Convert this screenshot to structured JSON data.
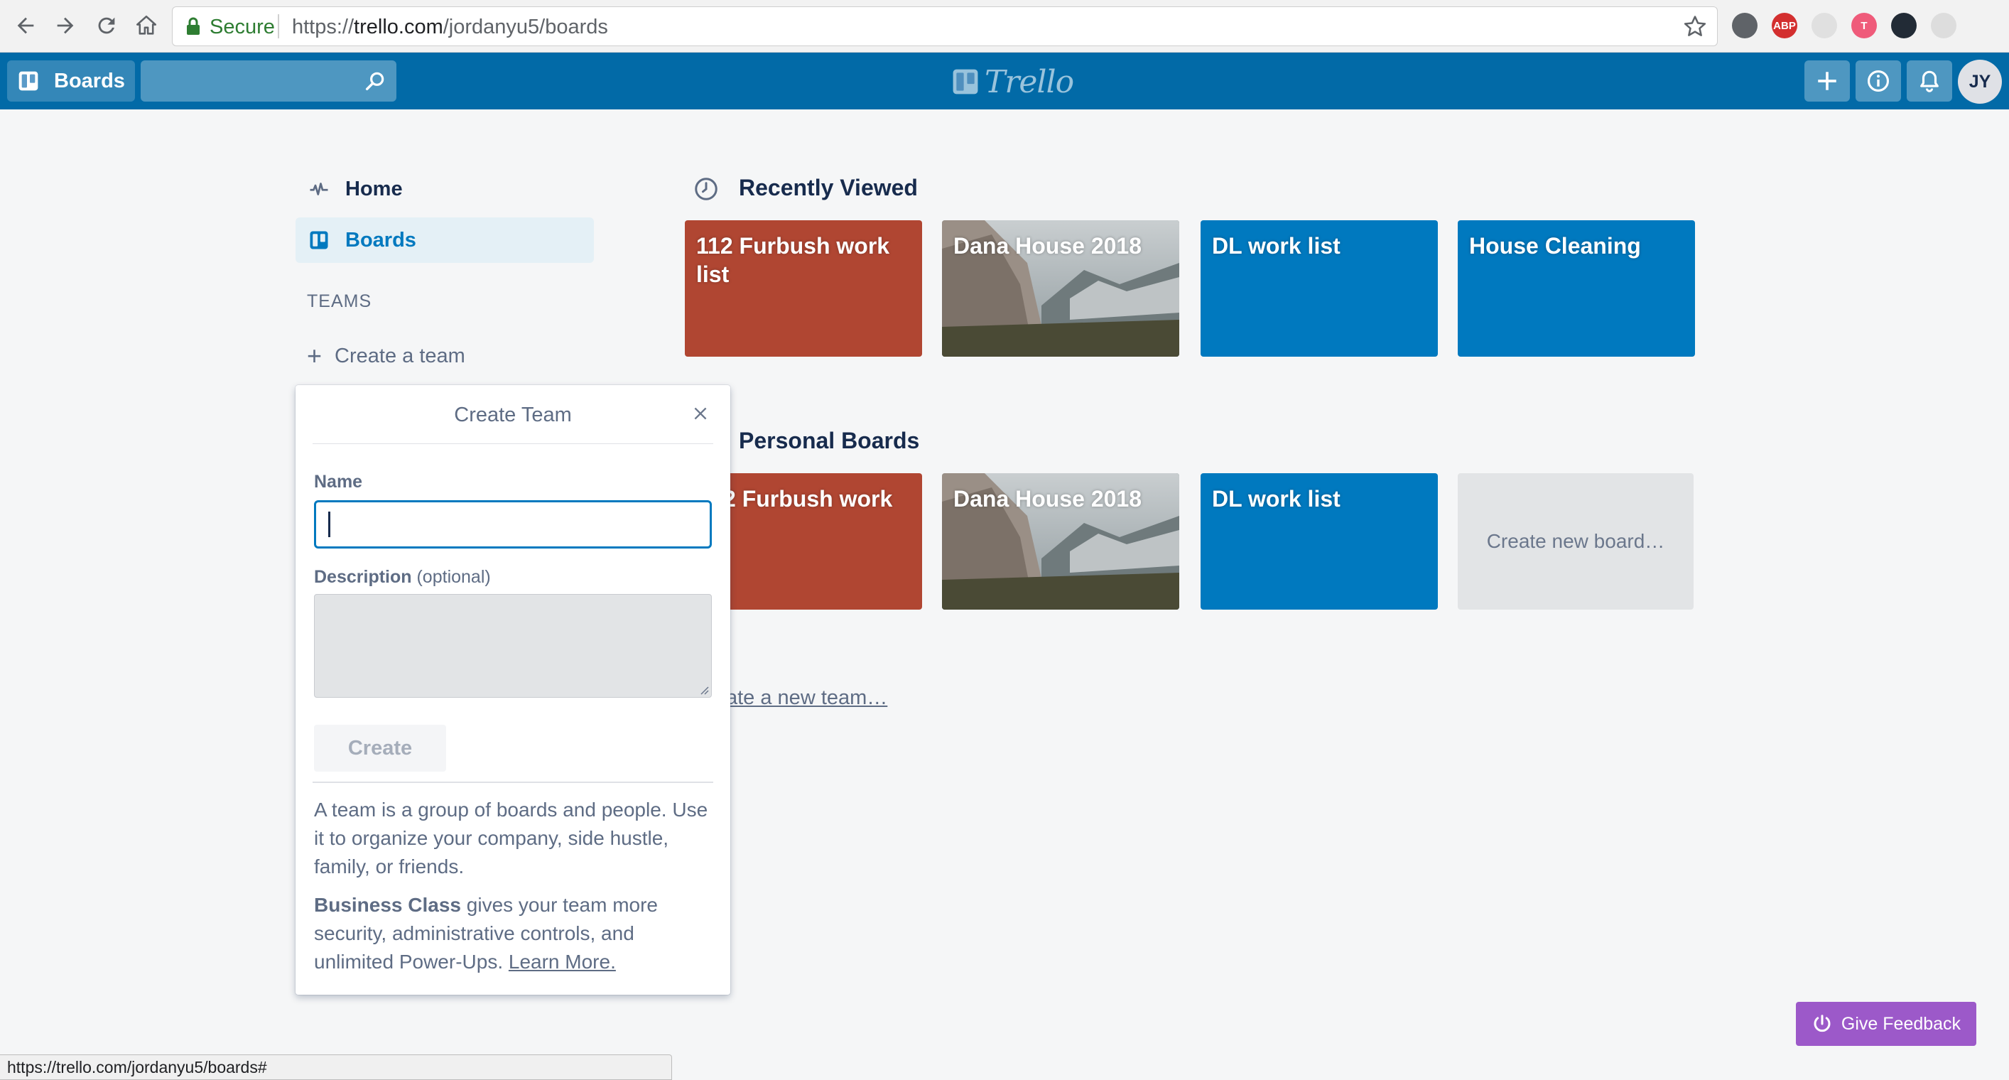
{
  "browser": {
    "secure_label": "Secure",
    "url_scheme": "https://",
    "url_host": "trello.com",
    "url_path": "/jordanyu5/boards",
    "extensions": [
      {
        "name": "evernote-icon",
        "label": "",
        "color": "#5f6368"
      },
      {
        "name": "adblock-plus-icon",
        "label": "ABP",
        "color": "#d32f2f"
      },
      {
        "name": "extension-icon",
        "label": "",
        "color": "#e0e0e0"
      },
      {
        "name": "extension-t-icon",
        "label": "T",
        "color": "#ef5b7a"
      },
      {
        "name": "react-devtools-icon",
        "label": "",
        "color": "#222b36"
      },
      {
        "name": "extension-circle-icon",
        "label": "",
        "color": "#dddddd"
      }
    ]
  },
  "header": {
    "boards_label": "Boards",
    "logo_text": "Trello",
    "avatar_initials": "JY",
    "brand_color": "#026aa7"
  },
  "sidebar": {
    "home_label": "Home",
    "boards_label": "Boards",
    "teams_label": "TEAMS",
    "create_team_label": "Create a team"
  },
  "recently_viewed": {
    "title": "Recently Viewed",
    "boards": [
      {
        "title": "112 Furbush work list",
        "style": "red"
      },
      {
        "title": "Dana House 2018",
        "style": "photo"
      },
      {
        "title": "DL work list",
        "style": "blue"
      },
      {
        "title": "House Cleaning",
        "style": "blue"
      }
    ]
  },
  "personal_boards": {
    "title": "Personal Boards",
    "boards": [
      {
        "title": "2 Furbush work",
        "style": "red"
      },
      {
        "title": "Dana House 2018",
        "style": "photo"
      },
      {
        "title": "DL work list",
        "style": "blue"
      }
    ],
    "create_new_board_label": "Create new board…",
    "create_new_team_link": "ate a new team…"
  },
  "create_team_popover": {
    "title": "Create Team",
    "name_label": "Name",
    "name_value": "",
    "description_label": "Description",
    "description_optional": "(optional)",
    "description_value": "",
    "create_button": "Create",
    "info_text": "A team is a group of boards and people. Use it to organize your company, side hustle, family, or friends.",
    "business_class_label": "Business Class",
    "business_class_text": "gives your team more security, administrative controls, and unlimited Power-Ups.",
    "learn_more_label": "Learn More."
  },
  "feedback_button": "Give Feedback",
  "status_bar_url": "https://trello.com/jordanyu5/boards#"
}
